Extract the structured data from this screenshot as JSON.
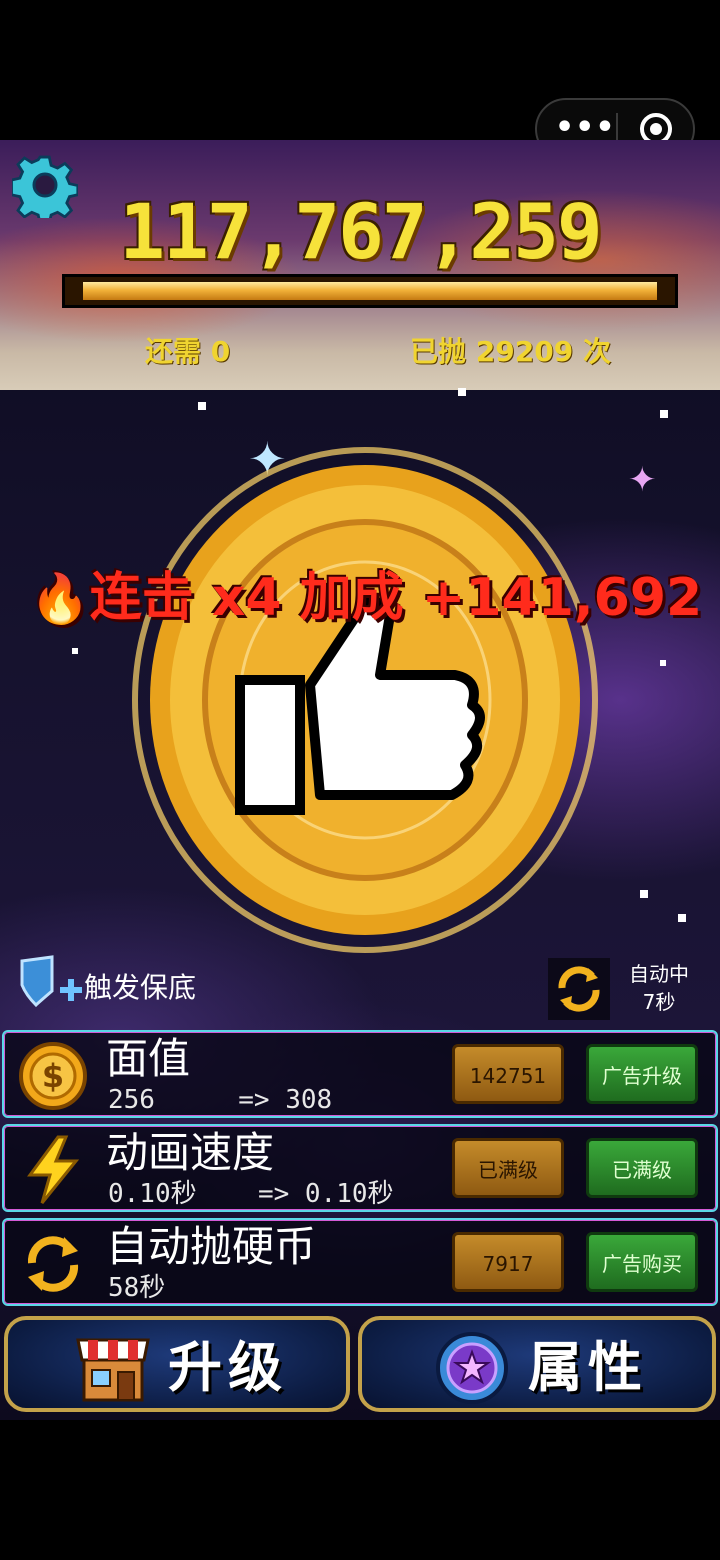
{
  "mini_program": {
    "more_icon": "more-dots-icon",
    "close_icon": "target-circle-icon"
  },
  "hud": {
    "settings_icon": "gear-icon",
    "coin_total": "117,767,259",
    "progress_fraction": 1.0,
    "need_label": "还需",
    "need_value": "0",
    "thrown_label": "已抛",
    "thrown_value": "29209",
    "thrown_unit": "次"
  },
  "coin": {
    "icon": "thumbs-up-coin-icon"
  },
  "combo": {
    "fire_icon": "fire-icon",
    "text": "连击 x4 加成 +141,692"
  },
  "guarantee": {
    "icon": "shield-plus-icon",
    "label": "触发保底"
  },
  "auto": {
    "icon": "auto-refresh-icon",
    "label": "自动中",
    "timer": "7秒"
  },
  "upgrades": [
    {
      "icon": "dollar-coin-icon",
      "title": "面值",
      "current": "256",
      "arrow": "=>",
      "next": "308",
      "cost": "142751",
      "ad_label": "广告升级"
    },
    {
      "icon": "lightning-icon",
      "title": "动画速度",
      "current": "0.10秒",
      "arrow": "=>",
      "next": "0.10秒",
      "cost": "已满级",
      "ad_label": "已满级"
    },
    {
      "icon": "auto-refresh-icon",
      "title": "自动抛硬币",
      "current": "58秒",
      "arrow": "",
      "next": "",
      "cost": "7917",
      "ad_label": "广告购买"
    }
  ],
  "bottom_nav": {
    "upgrade": {
      "icon": "shop-icon",
      "label": "升级"
    },
    "attributes": {
      "icon": "star-badge-icon",
      "label": "属性"
    }
  },
  "colors": {
    "score": "#f6e23a",
    "combo": "#ff2b1c",
    "row_border": "#5ad7e6",
    "gold_btn": "#c58b2a",
    "green_btn": "#3aa83a"
  }
}
